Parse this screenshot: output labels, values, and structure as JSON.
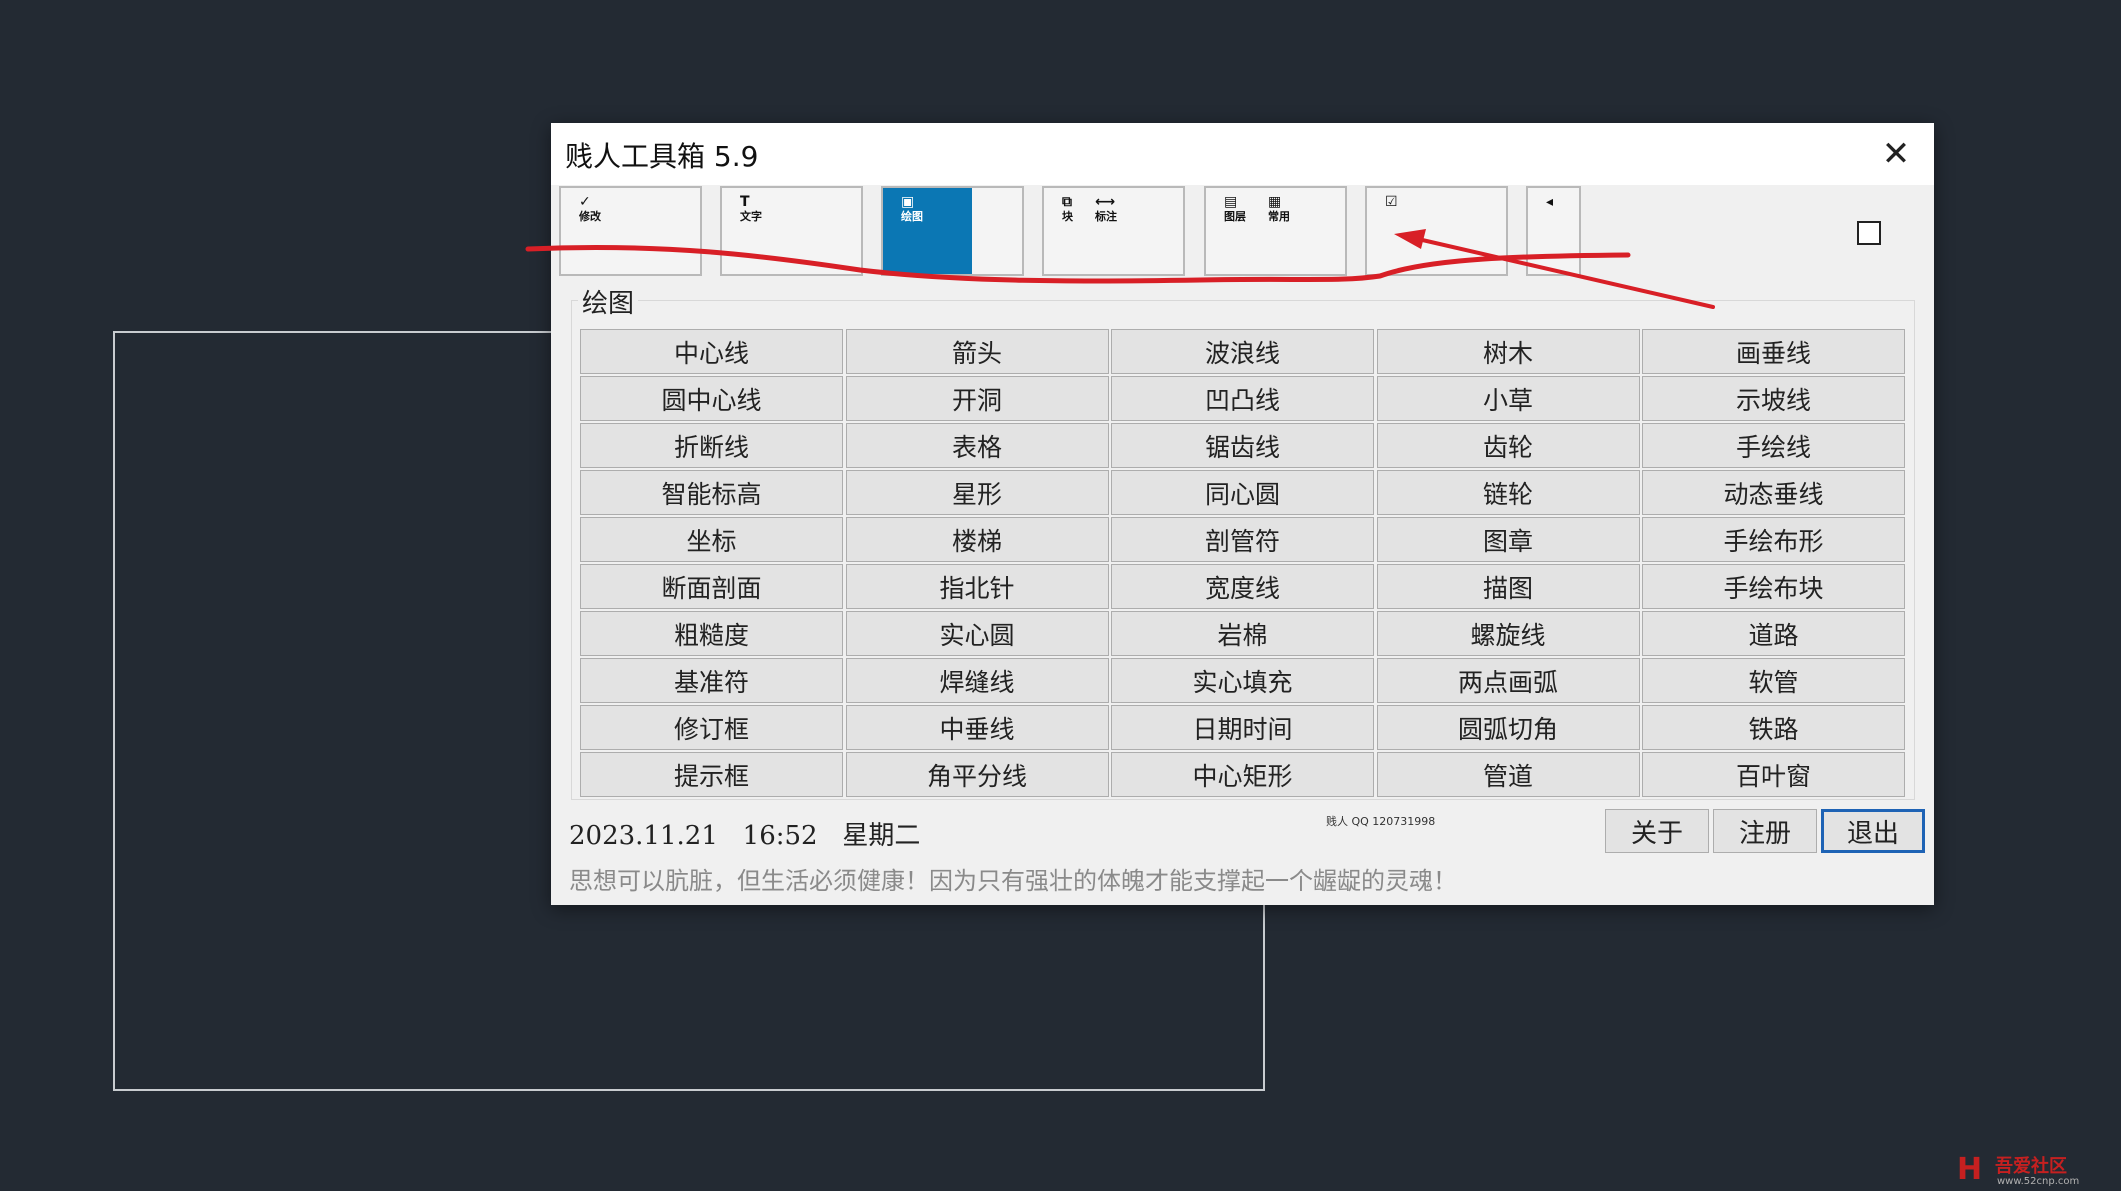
{
  "window": {
    "title": "贱人工具箱 5.9",
    "close_icon": "close-icon"
  },
  "tabs": [
    {
      "icons": [
        {
          "glyph": "✓",
          "label": "修改"
        }
      ]
    },
    {
      "icons": [
        {
          "glyph": "T",
          "label": "文字"
        }
      ]
    },
    {
      "icons": [
        {
          "glyph": "▣",
          "label": "绘图"
        }
      ],
      "active": true
    },
    {
      "icons": [
        {
          "glyph": "⧉",
          "label": "块"
        },
        {
          "glyph": "⟷",
          "label": "标注"
        }
      ]
    },
    {
      "icons": [
        {
          "glyph": "▤",
          "label": "图层"
        },
        {
          "glyph": "▦",
          "label": "常用"
        }
      ]
    },
    {
      "icons": [
        {
          "glyph": "☑",
          "label": ""
        }
      ]
    },
    {
      "icons": [
        {
          "glyph": "◂",
          "label": ""
        }
      ]
    }
  ],
  "group": {
    "label": "绘图",
    "buttons": [
      "中心线",
      "箭头",
      "波浪线",
      "树木",
      "画垂线",
      "圆中心线",
      "开洞",
      "凹凸线",
      "小草",
      "示坡线",
      "折断线",
      "表格",
      "锯齿线",
      "齿轮",
      "手绘线",
      "智能标高",
      "星形",
      "同心圆",
      "链轮",
      "动态垂线",
      "坐标",
      "楼梯",
      "剖管符",
      "图章",
      "手绘布形",
      "断面剖面",
      "指北针",
      "宽度线",
      "描图",
      "手绘布块",
      "粗糙度",
      "实心圆",
      "岩棉",
      "螺旋线",
      "道路",
      "基准符",
      "焊缝线",
      "实心填充",
      "两点画弧",
      "软管",
      "修订框",
      "中垂线",
      "日期时间",
      "圆弧切角",
      "铁路",
      "提示框",
      "角平分线",
      "中心矩形",
      "管道",
      "百叶窗"
    ]
  },
  "footer": {
    "date": "2023.11.21",
    "time": "16:52",
    "weekday": "星期二",
    "qq": "贱人 QQ 120731998",
    "about": "关于",
    "register": "注册",
    "exit": "退出",
    "motto": "思想可以肮脏，但生活必须健康！因为只有强壮的体魄才能支撑起一个龌龊的灵魂！"
  },
  "watermark": {
    "name": "吾爱社区",
    "url": "www.52cnp.com"
  },
  "colors": {
    "background": "#232a33",
    "active_tab": "#0b77b4",
    "annotation": "#d81f26",
    "focus_border": "#1e63b5"
  }
}
